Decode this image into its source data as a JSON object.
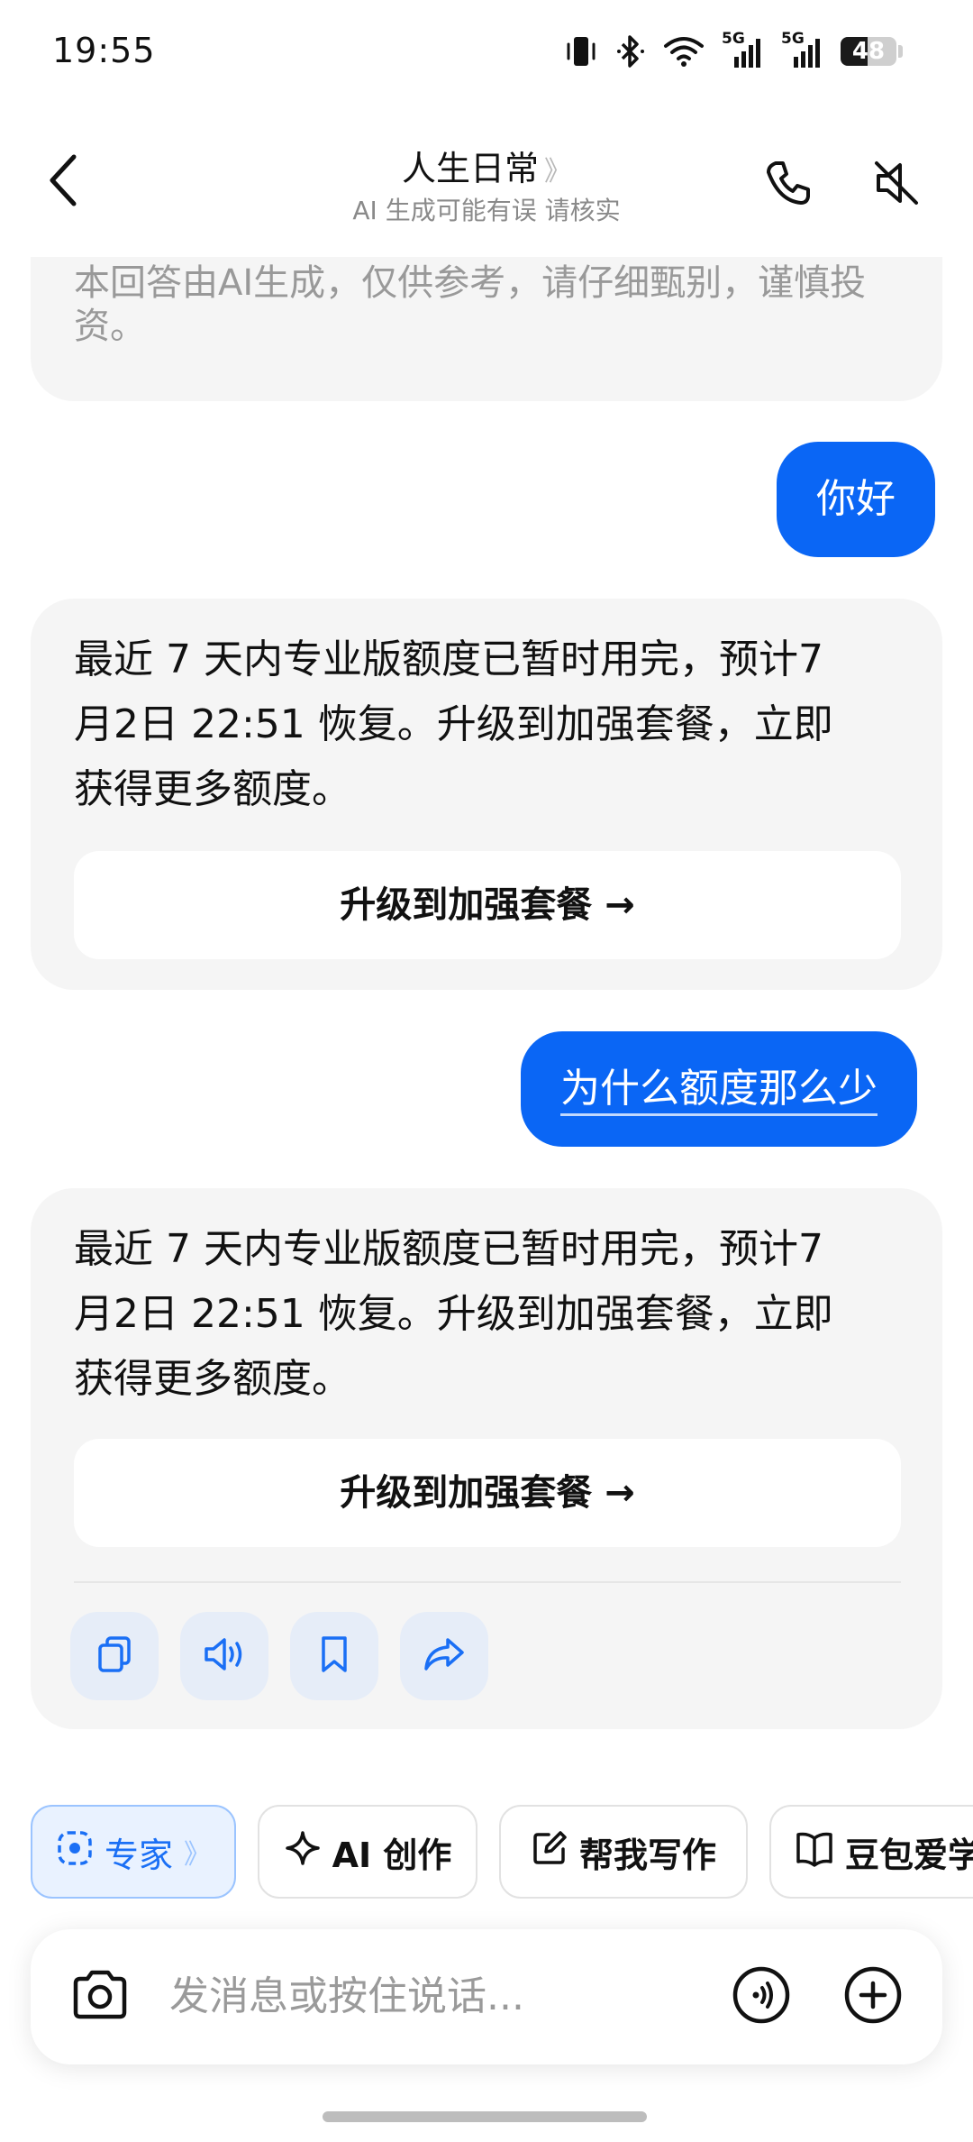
{
  "status_bar": {
    "time": "19:55",
    "battery_level": "48",
    "battery_fraction": 0.48,
    "network_1": "5G",
    "network_2": "5G",
    "icons": [
      "vibrate-icon",
      "bluetooth-icon",
      "wifi-icon",
      "signal-5g-icon",
      "signal-5g-icon",
      "battery-icon"
    ]
  },
  "header": {
    "title": "人生日常",
    "title_chevron": "》",
    "subtitle": "AI 生成可能有误 请核实",
    "icons": [
      "back-icon",
      "phone-icon",
      "speaker-muted-icon"
    ]
  },
  "chat": {
    "disclaimer": "本回答由AI生成，仅供参考，请仔细甄别，谨慎投资。",
    "messages": [
      {
        "role": "user",
        "text": "你好"
      },
      {
        "role": "assistant",
        "line1": "最近 7 天内专业版额度已暂时用完，预计7",
        "line2": "月2日 22:51 恢复。升级到加强套餐，立即",
        "line3": "获得更多额度。",
        "button": "升级到加强套餐 →"
      },
      {
        "role": "user",
        "text": "为什么额度那么少"
      },
      {
        "role": "assistant",
        "line1": "最近 7 天内专业版额度已暂时用完，预计7",
        "line2": "月2日 22:51 恢复。升级到加强套餐，立即",
        "line3": "获得更多额度。",
        "button": "升级到加强套餐 →"
      }
    ],
    "actions": [
      "copy-icon",
      "read-aloud-icon",
      "bookmark-icon",
      "share-icon"
    ]
  },
  "chips": [
    {
      "label": "专家",
      "chevron": "》",
      "icon": "expert-icon"
    },
    {
      "label": "AI 创作",
      "icon": "sparkle-icon"
    },
    {
      "label": "帮我写作",
      "icon": "edit-icon"
    },
    {
      "label": "豆包爱学",
      "icon": "book-icon"
    }
  ],
  "input": {
    "placeholder": "发消息或按住说话...",
    "icons": [
      "camera-icon",
      "voice-call-icon",
      "plus-icon"
    ]
  },
  "colors": {
    "accent": "#0a66f5",
    "ai_bubble": "#f5f5f5",
    "chip_expert_bg": "#e9f2ff",
    "action_bg": "#e6edf8"
  }
}
